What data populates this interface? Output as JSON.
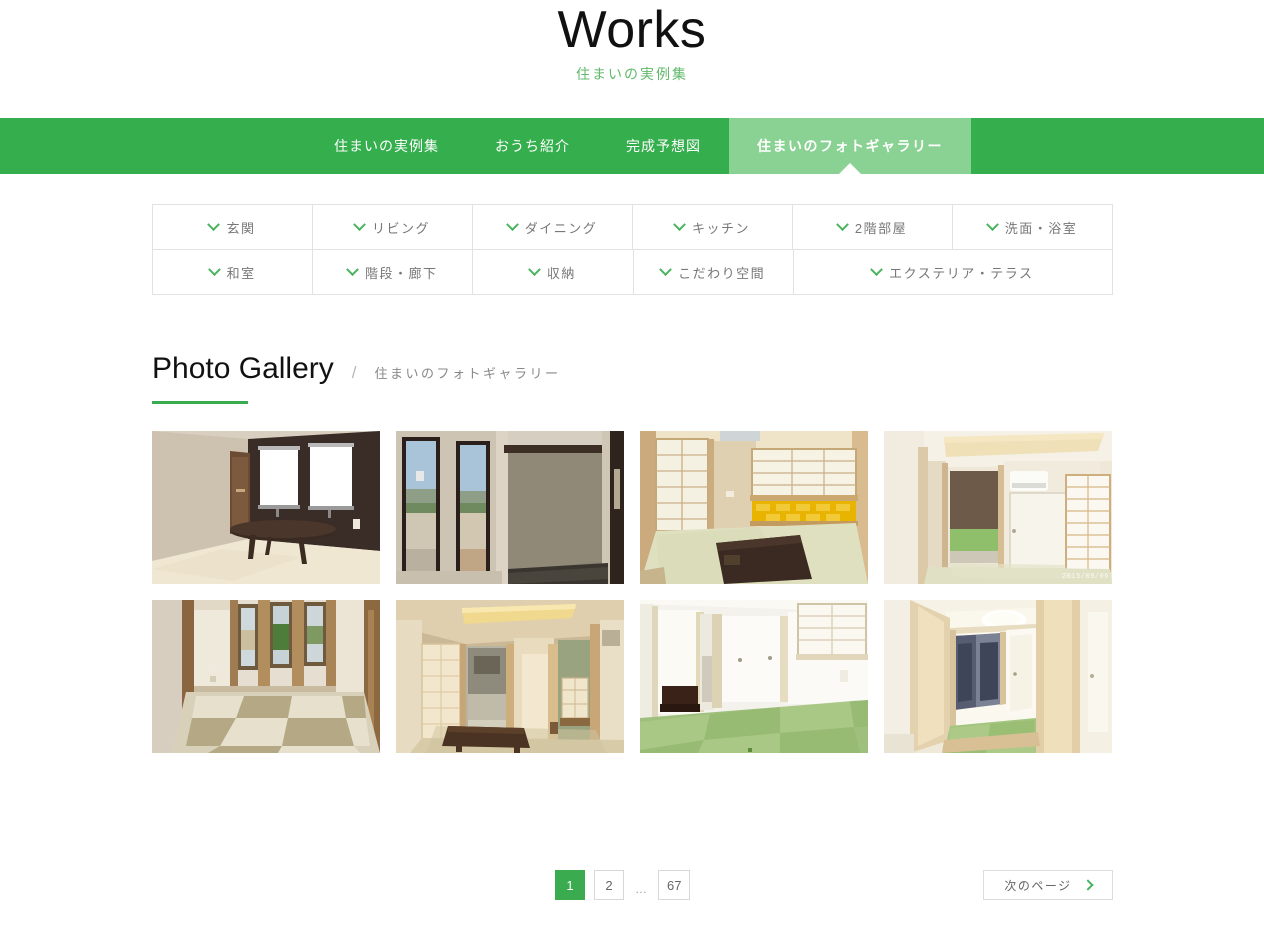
{
  "header": {
    "title": "Works",
    "subtitle": "住まいの実例集"
  },
  "nav": {
    "items": [
      {
        "label": "住まいの実例集",
        "active": false
      },
      {
        "label": "おうち紹介",
        "active": false
      },
      {
        "label": "完成予想図",
        "active": false
      },
      {
        "label": "住まいのフォトギャラリー",
        "active": true
      }
    ]
  },
  "filters": {
    "icon": "chevron-down-icon",
    "rows": [
      [
        {
          "label": "玄関",
          "wide": false
        },
        {
          "label": "リビング",
          "wide": false
        },
        {
          "label": "ダイニング",
          "wide": false
        },
        {
          "label": "キッチン",
          "wide": false
        },
        {
          "label": "2階部屋",
          "wide": false
        },
        {
          "label": "洗面・浴室",
          "wide": false
        }
      ],
      [
        {
          "label": "和室",
          "wide": false
        },
        {
          "label": "階段・廊下",
          "wide": false
        },
        {
          "label": "収納",
          "wide": false
        },
        {
          "label": "こだわり空間",
          "wide": false
        },
        {
          "label": "エクステリア・テラス",
          "wide": true
        }
      ]
    ]
  },
  "section": {
    "title_en": "Photo Gallery",
    "separator": "/",
    "title_ja": "住まいのフォトギャラリー",
    "accent_color": "#3aab4f"
  },
  "gallery": {
    "photos": [
      {
        "name": "washitsu-dark-accent-wall",
        "alt": "和室 ダークブラウンのアクセントウォールと座卓",
        "watermark": ""
      },
      {
        "name": "room-windows-tokonoma",
        "alt": "窓から景色が見える和室と床の間",
        "watermark": ""
      },
      {
        "name": "washitsu-gold-panel",
        "alt": "障子と金色の壁パネルがある和室",
        "watermark": ""
      },
      {
        "name": "washitsu-indirect-lighting",
        "alt": "間接照明とロールスクリーンのある和室",
        "watermark": "2015/09/06"
      },
      {
        "name": "ryukyu-tatami-checker",
        "alt": "市松敷きの琉球畳と縦長窓の和室",
        "watermark": ""
      },
      {
        "name": "warm-lit-washitsu",
        "alt": "夕日が差し込む和室と床の間",
        "watermark": ""
      },
      {
        "name": "green-tatami-room",
        "alt": "緑の琉球畳と障子窓の和室",
        "watermark": ""
      },
      {
        "name": "tatami-room-through-doorway",
        "alt": "木枠の開口から見る緑の畳の和室",
        "watermark": ""
      }
    ]
  },
  "pagination": {
    "pages": [
      {
        "label": "1",
        "active": true
      },
      {
        "label": "2",
        "active": false
      }
    ],
    "ellipsis": "…",
    "last_page": "67",
    "next_label": "次のページ",
    "next_icon": "chevron-right-icon",
    "active_color": "#3aab4f"
  }
}
